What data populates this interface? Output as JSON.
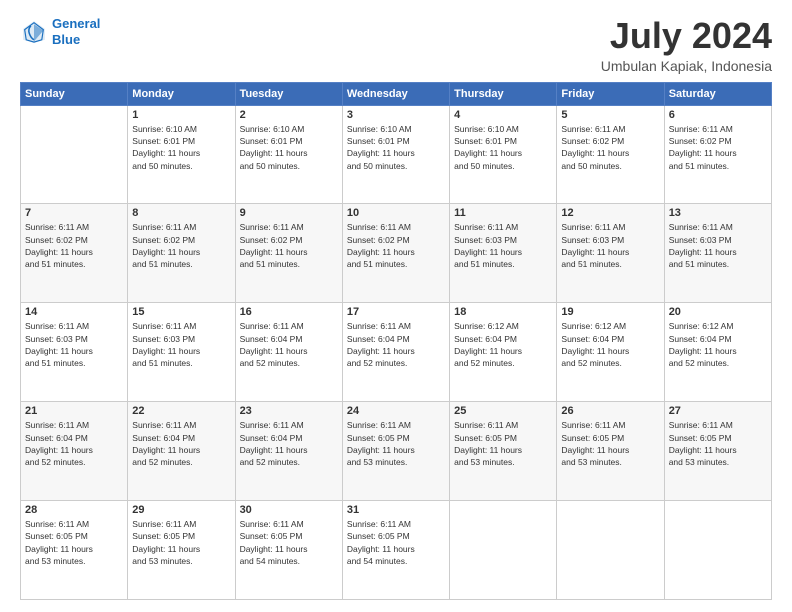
{
  "logo": {
    "line1": "General",
    "line2": "Blue"
  },
  "title": "July 2024",
  "location": "Umbulan Kapiak, Indonesia",
  "days_header": [
    "Sunday",
    "Monday",
    "Tuesday",
    "Wednesday",
    "Thursday",
    "Friday",
    "Saturday"
  ],
  "weeks": [
    [
      {
        "num": "",
        "detail": ""
      },
      {
        "num": "1",
        "detail": "Sunrise: 6:10 AM\nSunset: 6:01 PM\nDaylight: 11 hours\nand 50 minutes."
      },
      {
        "num": "2",
        "detail": "Sunrise: 6:10 AM\nSunset: 6:01 PM\nDaylight: 11 hours\nand 50 minutes."
      },
      {
        "num": "3",
        "detail": "Sunrise: 6:10 AM\nSunset: 6:01 PM\nDaylight: 11 hours\nand 50 minutes."
      },
      {
        "num": "4",
        "detail": "Sunrise: 6:10 AM\nSunset: 6:01 PM\nDaylight: 11 hours\nand 50 minutes."
      },
      {
        "num": "5",
        "detail": "Sunrise: 6:11 AM\nSunset: 6:02 PM\nDaylight: 11 hours\nand 50 minutes."
      },
      {
        "num": "6",
        "detail": "Sunrise: 6:11 AM\nSunset: 6:02 PM\nDaylight: 11 hours\nand 51 minutes."
      }
    ],
    [
      {
        "num": "7",
        "detail": "Sunrise: 6:11 AM\nSunset: 6:02 PM\nDaylight: 11 hours\nand 51 minutes."
      },
      {
        "num": "8",
        "detail": "Sunrise: 6:11 AM\nSunset: 6:02 PM\nDaylight: 11 hours\nand 51 minutes."
      },
      {
        "num": "9",
        "detail": "Sunrise: 6:11 AM\nSunset: 6:02 PM\nDaylight: 11 hours\nand 51 minutes."
      },
      {
        "num": "10",
        "detail": "Sunrise: 6:11 AM\nSunset: 6:02 PM\nDaylight: 11 hours\nand 51 minutes."
      },
      {
        "num": "11",
        "detail": "Sunrise: 6:11 AM\nSunset: 6:03 PM\nDaylight: 11 hours\nand 51 minutes."
      },
      {
        "num": "12",
        "detail": "Sunrise: 6:11 AM\nSunset: 6:03 PM\nDaylight: 11 hours\nand 51 minutes."
      },
      {
        "num": "13",
        "detail": "Sunrise: 6:11 AM\nSunset: 6:03 PM\nDaylight: 11 hours\nand 51 minutes."
      }
    ],
    [
      {
        "num": "14",
        "detail": "Sunrise: 6:11 AM\nSunset: 6:03 PM\nDaylight: 11 hours\nand 51 minutes."
      },
      {
        "num": "15",
        "detail": "Sunrise: 6:11 AM\nSunset: 6:03 PM\nDaylight: 11 hours\nand 51 minutes."
      },
      {
        "num": "16",
        "detail": "Sunrise: 6:11 AM\nSunset: 6:04 PM\nDaylight: 11 hours\nand 52 minutes."
      },
      {
        "num": "17",
        "detail": "Sunrise: 6:11 AM\nSunset: 6:04 PM\nDaylight: 11 hours\nand 52 minutes."
      },
      {
        "num": "18",
        "detail": "Sunrise: 6:12 AM\nSunset: 6:04 PM\nDaylight: 11 hours\nand 52 minutes."
      },
      {
        "num": "19",
        "detail": "Sunrise: 6:12 AM\nSunset: 6:04 PM\nDaylight: 11 hours\nand 52 minutes."
      },
      {
        "num": "20",
        "detail": "Sunrise: 6:12 AM\nSunset: 6:04 PM\nDaylight: 11 hours\nand 52 minutes."
      }
    ],
    [
      {
        "num": "21",
        "detail": "Sunrise: 6:11 AM\nSunset: 6:04 PM\nDaylight: 11 hours\nand 52 minutes."
      },
      {
        "num": "22",
        "detail": "Sunrise: 6:11 AM\nSunset: 6:04 PM\nDaylight: 11 hours\nand 52 minutes."
      },
      {
        "num": "23",
        "detail": "Sunrise: 6:11 AM\nSunset: 6:04 PM\nDaylight: 11 hours\nand 52 minutes."
      },
      {
        "num": "24",
        "detail": "Sunrise: 6:11 AM\nSunset: 6:05 PM\nDaylight: 11 hours\nand 53 minutes."
      },
      {
        "num": "25",
        "detail": "Sunrise: 6:11 AM\nSunset: 6:05 PM\nDaylight: 11 hours\nand 53 minutes."
      },
      {
        "num": "26",
        "detail": "Sunrise: 6:11 AM\nSunset: 6:05 PM\nDaylight: 11 hours\nand 53 minutes."
      },
      {
        "num": "27",
        "detail": "Sunrise: 6:11 AM\nSunset: 6:05 PM\nDaylight: 11 hours\nand 53 minutes."
      }
    ],
    [
      {
        "num": "28",
        "detail": "Sunrise: 6:11 AM\nSunset: 6:05 PM\nDaylight: 11 hours\nand 53 minutes."
      },
      {
        "num": "29",
        "detail": "Sunrise: 6:11 AM\nSunset: 6:05 PM\nDaylight: 11 hours\nand 53 minutes."
      },
      {
        "num": "30",
        "detail": "Sunrise: 6:11 AM\nSunset: 6:05 PM\nDaylight: 11 hours\nand 54 minutes."
      },
      {
        "num": "31",
        "detail": "Sunrise: 6:11 AM\nSunset: 6:05 PM\nDaylight: 11 hours\nand 54 minutes."
      },
      {
        "num": "",
        "detail": ""
      },
      {
        "num": "",
        "detail": ""
      },
      {
        "num": "",
        "detail": ""
      }
    ]
  ]
}
